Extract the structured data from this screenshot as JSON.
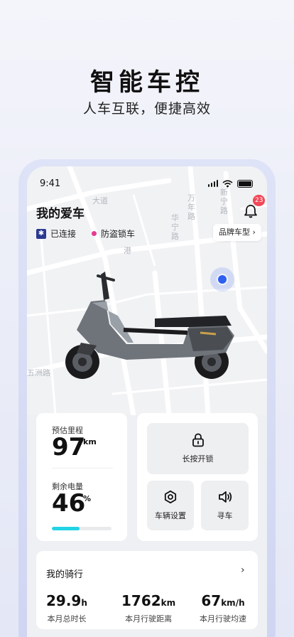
{
  "promo": {
    "title": "智能车控",
    "subtitle": "人车互联，便捷高效"
  },
  "status_bar": {
    "time": "9:41"
  },
  "header": {
    "title": "我的爱车",
    "notification_count": "23"
  },
  "connection": {
    "bluetooth_status": "已连接",
    "security_status": "防盗锁车",
    "brand_button": "品牌车型 ›"
  },
  "map": {
    "labels": [
      "大道",
      "万年路",
      "华宁路",
      "新宁路",
      "五洲路",
      "港"
    ]
  },
  "stats": {
    "range_label": "预估里程",
    "range_value": "97",
    "range_unit": "km",
    "battery_label": "剩余电量",
    "battery_value": "46",
    "battery_unit": "%",
    "battery_level": 0.46
  },
  "actions": {
    "unlock_label": "长按开锁",
    "settings_label": "车辆设置",
    "find_label": "寻车"
  },
  "rides": {
    "title": "我的骑行",
    "arrow": "›",
    "items": [
      {
        "value": "29.9",
        "unit": "h",
        "caption": "本月总时长"
      },
      {
        "value": "1762",
        "unit": "km",
        "caption": "本月行驶距离"
      },
      {
        "value": "67",
        "unit": "km/h",
        "caption": "本月行驶均速"
      }
    ]
  },
  "colors": {
    "accent_blue": "#2e5ff0",
    "battery_cyan": "#22d3e6",
    "badge_red": "#f24857",
    "bluetooth_navy": "#2b3a8f",
    "security_pink": "#e63a8f"
  }
}
